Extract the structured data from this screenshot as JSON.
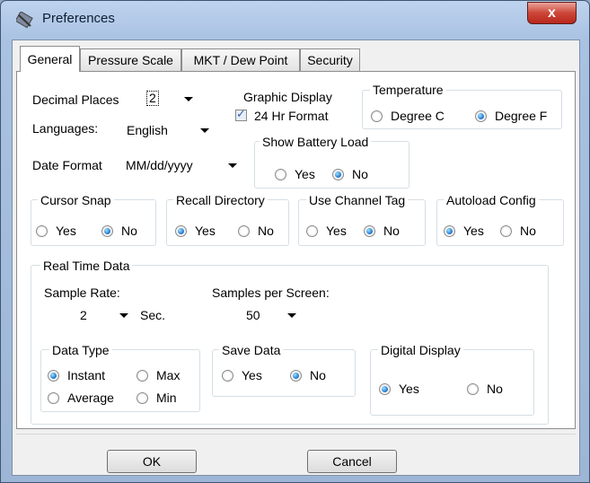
{
  "window": {
    "title": "Preferences",
    "close_glyph": "x"
  },
  "tabs": [
    "General",
    "Pressure Scale",
    "MKT / Dew Point",
    "Security"
  ],
  "general": {
    "decimal_places": {
      "label": "Decimal Places",
      "value": "2"
    },
    "languages": {
      "label": "Languages:",
      "value": "English"
    },
    "date_format": {
      "label": "Date Format",
      "value": "MM/dd/yyyy"
    },
    "graphic_display": {
      "label": "Graphic Display",
      "option": "24 Hr Format",
      "checked": true
    },
    "temperature": {
      "label": "Temperature",
      "options": [
        "Degree C",
        "Degree F"
      ],
      "selected": "Degree F"
    },
    "show_battery_load": {
      "label": "Show Battery Load",
      "options": [
        "Yes",
        "No"
      ],
      "selected": "No"
    },
    "cursor_snap": {
      "label": "Cursor Snap",
      "options": [
        "Yes",
        "No"
      ],
      "selected": "No"
    },
    "recall_directory": {
      "label": "Recall Directory",
      "options": [
        "Yes",
        "No"
      ],
      "selected": "Yes"
    },
    "use_channel_tag": {
      "label": "Use Channel Tag",
      "options": [
        "Yes",
        "No"
      ],
      "selected": "No"
    },
    "autoload_config": {
      "label": "Autoload Config",
      "options": [
        "Yes",
        "No"
      ],
      "selected": "Yes"
    }
  },
  "real_time": {
    "label": "Real Time Data",
    "sample_rate": {
      "label": "Sample Rate:",
      "value": "2",
      "unit": "Sec."
    },
    "samples_per_screen": {
      "label": "Samples per Screen:",
      "value": "50"
    },
    "data_type": {
      "label": "Data Type",
      "options": [
        "Instant",
        "Max",
        "Average",
        "Min"
      ],
      "selected": "Instant"
    },
    "save_data": {
      "label": "Save Data",
      "options": [
        "Yes",
        "No"
      ],
      "selected": "No"
    },
    "digital_display": {
      "label": "Digital Display",
      "options": [
        "Yes",
        "No"
      ],
      "selected": "Yes"
    }
  },
  "buttons": {
    "ok": "OK",
    "cancel": "Cancel"
  },
  "colors": {
    "accent": "#1c70c8",
    "title_bar": "#a9c2e2",
    "close": "#cc4637"
  },
  "icons": {
    "app": "pencil-ruler-icon",
    "close": "close-icon"
  }
}
